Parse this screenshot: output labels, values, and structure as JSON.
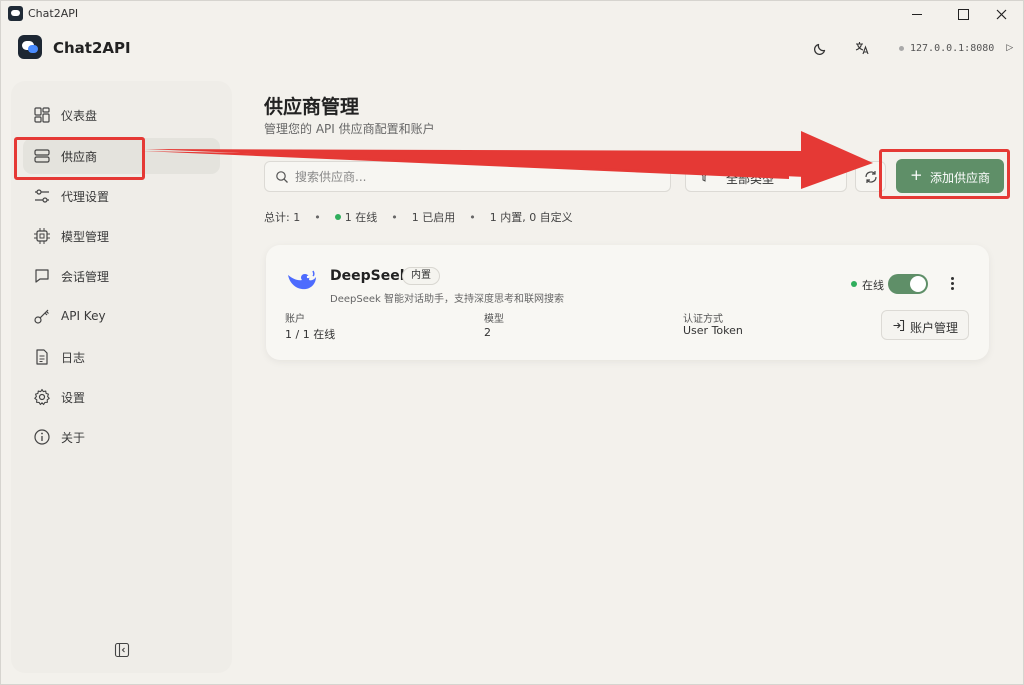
{
  "window": {
    "title": "Chat2API"
  },
  "header": {
    "app_name": "Chat2API",
    "server_address": "127.0.0.1:8080"
  },
  "sidebar": {
    "items": [
      {
        "label": "仪表盘",
        "icon": "dashboard-icon",
        "active": false
      },
      {
        "label": "供应商",
        "icon": "server-icon",
        "active": true
      },
      {
        "label": "代理设置",
        "icon": "sliders-icon",
        "active": false
      },
      {
        "label": "模型管理",
        "icon": "chip-icon",
        "active": false
      },
      {
        "label": "会话管理",
        "icon": "chat-icon",
        "active": false
      },
      {
        "label": "API Key",
        "icon": "key-icon",
        "active": false
      },
      {
        "label": "日志",
        "icon": "document-icon",
        "active": false
      },
      {
        "label": "设置",
        "icon": "gear-icon",
        "active": false
      },
      {
        "label": "关于",
        "icon": "info-icon",
        "active": false
      }
    ]
  },
  "main": {
    "title": "供应商管理",
    "subtitle": "管理您的 API 供应商配置和账户",
    "search_placeholder": "搜索供应商...",
    "filter_label": "全部类型",
    "add_button": "添加供应商",
    "stats": {
      "total": "总计: 1",
      "online": "1 在线",
      "enabled": "1 已启用",
      "builtin": "1 内置, 0 自定义"
    },
    "providers": [
      {
        "name": "DeepSeek",
        "badge": "内置",
        "description": "DeepSeek 智能对话助手，支持深度思考和联网搜索",
        "status": "在线",
        "enabled": true,
        "accounts_label": "账户",
        "accounts_value": "1 / 1 在线",
        "models_label": "模型",
        "models_value": "2",
        "auth_label": "认证方式",
        "auth_value": "User Token",
        "account_button": "账户管理"
      }
    ]
  },
  "colors": {
    "accent": "#5f8f68",
    "online": "#2fae5c",
    "annotation": "#e53935"
  }
}
